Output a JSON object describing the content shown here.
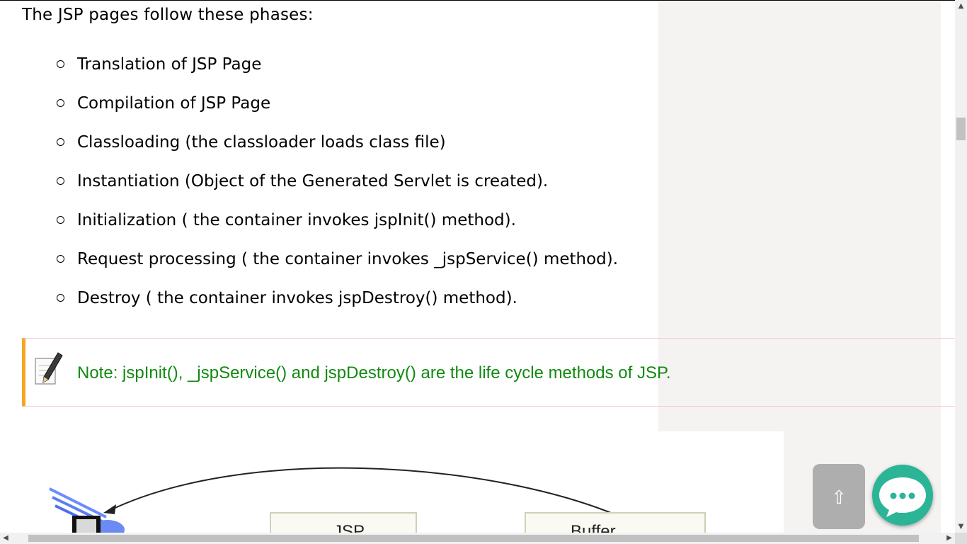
{
  "intro_text": "The JSP pages follow these phases:",
  "phases": [
    "Translation of JSP Page",
    "Compilation of JSP Page",
    "Classloading (the classloader loads class file)",
    "Instantiation (Object of the Generated Servlet is created).",
    "Initialization ( the container invokes jspInit() method).",
    "Request processing ( the container invokes _jspService() method).",
    "Destroy ( the container invokes jspDestroy() method)."
  ],
  "note_text": "Note: jspInit(), _jspService() and jspDestroy() are the life cycle methods of JSP.",
  "diagram": {
    "box1_label": "JSP",
    "box2_label": "Buffer"
  },
  "scroll_top_symbol": "⇧",
  "colors": {
    "note_text": "#118a11",
    "note_border": "#f5a623",
    "chat": "#2bb596",
    "side_panel": "#f5f2f2"
  },
  "icons": {
    "note": "pencil-note-icon",
    "chat": "chat-bubble-icon",
    "scroll_top": "arrow-up-icon"
  }
}
